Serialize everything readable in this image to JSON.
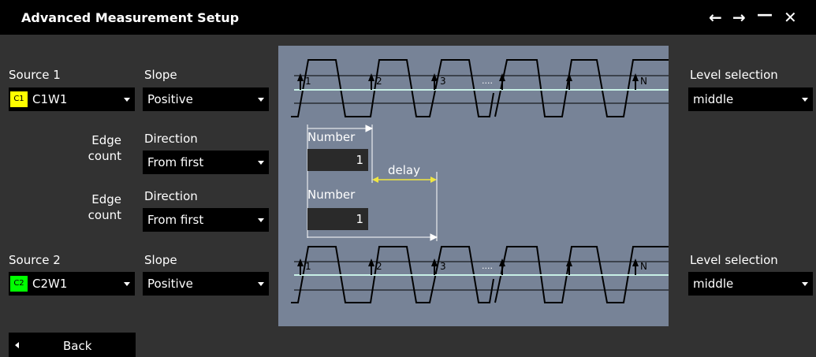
{
  "window": {
    "title": "Advanced Measurement Setup",
    "back_icon": "←",
    "forward_icon": "→",
    "minimize_icon": "—",
    "close_icon": "✕"
  },
  "source1": {
    "label": "Source 1",
    "badge": "C1",
    "badge_color": "#ffff00",
    "value": "C1W1",
    "slope_label": "Slope",
    "slope_value": "Positive",
    "level_label": "Level selection",
    "level_value": "middle"
  },
  "edge1": {
    "label_line1": "Edge",
    "label_line2": "count",
    "direction_label": "Direction",
    "direction_value": "From first"
  },
  "edge2": {
    "label_line1": "Edge",
    "label_line2": "count",
    "direction_label": "Direction",
    "direction_value": "From first"
  },
  "source2": {
    "label": "Source 2",
    "badge": "C2",
    "badge_color": "#00ff00",
    "value": "C2W1",
    "slope_label": "Slope",
    "slope_value": "Positive",
    "level_label": "Level selection",
    "level_value": "middle"
  },
  "diagram": {
    "top_edge_labels": [
      "1",
      "2",
      "3",
      "N"
    ],
    "bottom_edge_labels": [
      "1",
      "2",
      "3",
      "N"
    ],
    "ellipsis": "....",
    "number1_label": "Number",
    "number1_value": "1",
    "number2_label": "Number",
    "number2_value": "1",
    "delay_label": "delay",
    "level_line_color": "#c8f0e6",
    "delay_color": "#f0e640"
  },
  "footer": {
    "back_label": "Back"
  }
}
